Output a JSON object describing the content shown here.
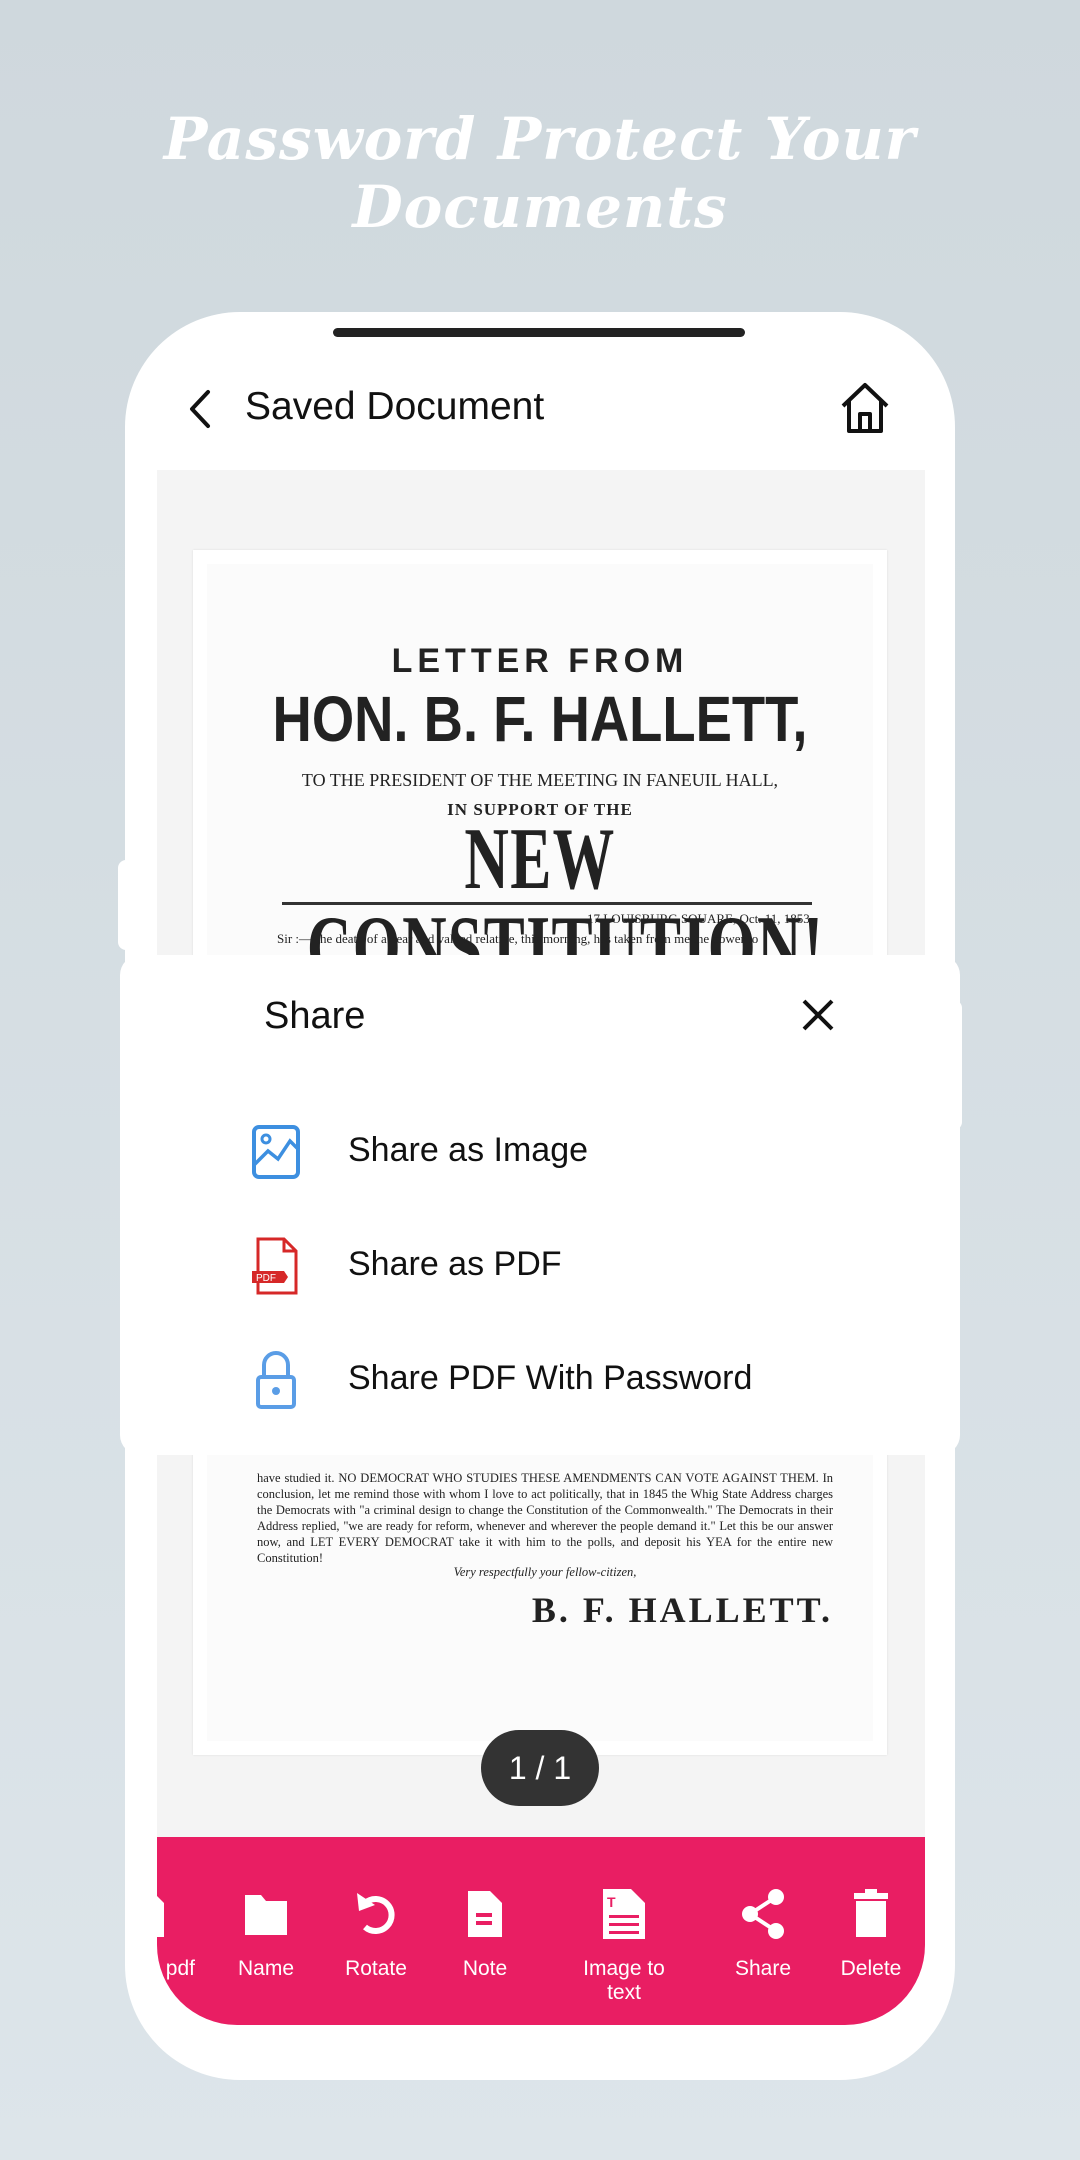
{
  "headline": "Password Protect Your Documents",
  "header": {
    "title": "Saved Document",
    "back_icon": "chevron-left-icon",
    "home_icon": "home-icon"
  },
  "document": {
    "line1": "LETTER FROM",
    "line2": "HON. B. F. HALLETT,",
    "line3": "TO THE PRESIDENT OF THE MEETING IN FANEUIL HALL,",
    "line4": "IN SUPPORT OF THE",
    "line5": "NEW  CONSTITUTION!",
    "address": "17 LOUISBURG SQUARE, Oct. 11, 1853.",
    "opening": "Sir :—The death of a near and valued relative, this morning, has taken from me the power to",
    "closing_text": "have studied it. NO DEMOCRAT WHO STUDIES THESE AMENDMENTS CAN VOTE AGAINST THEM. In conclusion, let me remind those with whom I love to act politically, that in 1845 the Whig State Address charges the Democrats with \"a criminal design to change the Constitution of the Commonwealth.\" The Democrats in their Address replied, \"we are ready for reform, whenever and wherever the people demand it.\" Let this be our answer now, and LET EVERY DEMOCRAT take it with him to the polls, and deposit his YEA for the entire new Constitution!",
    "valediction": "Very respectfully your fellow-citizen,",
    "signature": "B. F. HALLETT."
  },
  "page_indicator": "1 / 1",
  "share_sheet": {
    "title": "Share",
    "close_icon": "close-icon",
    "items": [
      {
        "label": "Share as Image",
        "icon": "image-icon",
        "color": "#3d8fe0"
      },
      {
        "label": "Share as PDF",
        "icon": "pdf-file-icon",
        "color": "#d62828"
      },
      {
        "label": "Share PDF With Password",
        "icon": "lock-icon",
        "color": "#5a9de6"
      }
    ]
  },
  "toolbar": {
    "background": "#e91e63",
    "items": [
      {
        "label": "pdf",
        "icon": "pdf-icon"
      },
      {
        "label": "Name",
        "icon": "folder-icon"
      },
      {
        "label": "Rotate",
        "icon": "rotate-icon"
      },
      {
        "label": "Note",
        "icon": "note-icon"
      },
      {
        "label": "Image to text",
        "icon": "image-to-text-icon"
      },
      {
        "label": "Share",
        "icon": "share-icon"
      },
      {
        "label": "Delete",
        "icon": "trash-icon"
      }
    ]
  }
}
